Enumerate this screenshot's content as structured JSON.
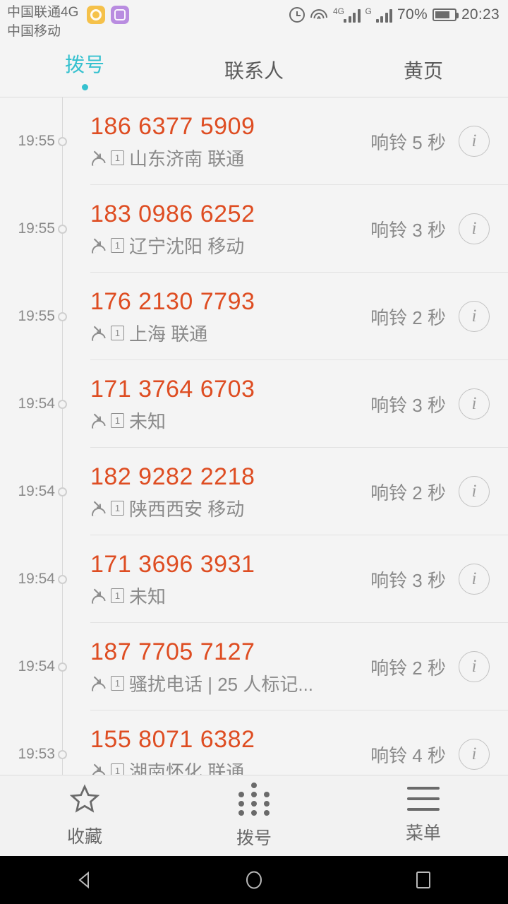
{
  "status_bar": {
    "carrier_primary": "中国联通4G",
    "carrier_secondary": "中国移动",
    "notification_icons": [
      "notification-amber-icon",
      "notification-purple-icon"
    ],
    "alarm_icon": "alarm-clock-icon",
    "wifi_icon": "wifi-icon",
    "signal_1_label": "4G",
    "signal_2_label": "G",
    "battery_percent": "70%",
    "battery_icon": "battery-icon",
    "clock": "20:23"
  },
  "tabs": [
    {
      "label": "拨号",
      "active": true
    },
    {
      "label": "联系人",
      "active": false
    },
    {
      "label": "黄页",
      "active": false
    }
  ],
  "colors": {
    "accent_tab": "#35c1cf",
    "number_orange": "#de4d22",
    "secondary_text": "#8a8a8a",
    "background": "#f4f4f4"
  },
  "call_log": {
    "call_type_icon": "missed-call-icon",
    "sim_badge": "1",
    "info_icon": "info-icon",
    "rows": [
      {
        "time": "19:55",
        "number": "186 6377 5909",
        "location": "山东济南 联通",
        "duration": "响铃 5 秒"
      },
      {
        "time": "19:55",
        "number": "183 0986 6252",
        "location": "辽宁沈阳 移动",
        "duration": "响铃 3 秒"
      },
      {
        "time": "19:55",
        "number": "176 2130 7793",
        "location": "上海 联通",
        "duration": "响铃 2 秒"
      },
      {
        "time": "19:54",
        "number": "171 3764 6703",
        "location": "未知",
        "duration": "响铃 3 秒"
      },
      {
        "time": "19:54",
        "number": "182 9282 2218",
        "location": "陕西西安 移动",
        "duration": "响铃 2 秒"
      },
      {
        "time": "19:54",
        "number": "171 3696 3931",
        "location": "未知",
        "duration": "响铃 3 秒"
      },
      {
        "time": "19:54",
        "number": "187 7705 7127",
        "location": "骚扰电话 | 25 人标记...",
        "duration": "响铃 2 秒"
      },
      {
        "time": "19:53",
        "number": "155 8071 6382",
        "location": "湖南怀化 联通",
        "duration": "响铃 4 秒"
      }
    ]
  },
  "bottom_bar": [
    {
      "label": "收藏",
      "icon": "star-icon"
    },
    {
      "label": "拨号",
      "icon": "dialpad-icon"
    },
    {
      "label": "菜单",
      "icon": "menu-icon"
    }
  ],
  "nav_bar": {
    "back": "back-icon",
    "home": "home-icon",
    "recents": "recents-icon"
  }
}
